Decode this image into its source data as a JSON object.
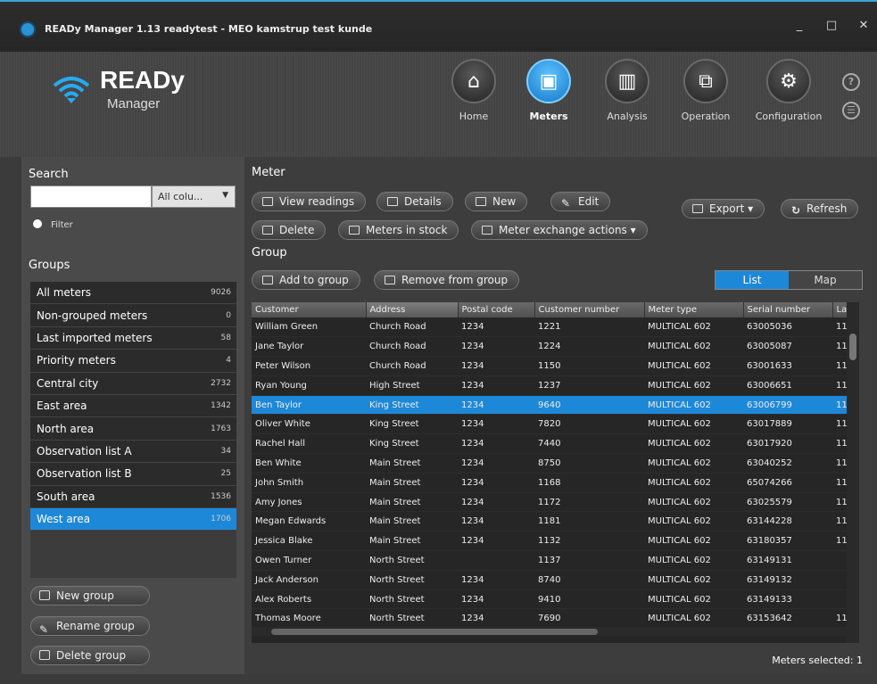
{
  "window": {
    "title": "READy Manager 1.13 readytest - MEO kamstrup test kunde",
    "minimize": "_",
    "maximize": "□",
    "close": "✕"
  },
  "logo": {
    "title": "READy",
    "subtitle": "Manager"
  },
  "nav": [
    {
      "label": "Home",
      "icon": "home-icon",
      "glyph": "⌂",
      "active": false
    },
    {
      "label": "Meters",
      "icon": "meter-icon",
      "glyph": "▣",
      "active": true
    },
    {
      "label": "Analysis",
      "icon": "chart-icon",
      "glyph": "▥",
      "active": false
    },
    {
      "label": "Operation",
      "icon": "operation-icon",
      "glyph": "⧉",
      "active": false
    },
    {
      "label": "Configuration",
      "icon": "gear-icon",
      "glyph": "⚙",
      "active": false
    }
  ],
  "help": {
    "glyph": "?",
    "info_glyph": "☰"
  },
  "search": {
    "heading": "Search",
    "value": "",
    "column_select": "All colu...",
    "filter_label": "Filter"
  },
  "groups": {
    "heading": "Groups",
    "items": [
      {
        "name": "All meters",
        "count": "9026"
      },
      {
        "name": "Non-grouped meters",
        "count": "0"
      },
      {
        "name": "Last imported meters",
        "count": "58"
      },
      {
        "name": "Priority meters",
        "count": "4"
      },
      {
        "name": "Central city",
        "count": "2732"
      },
      {
        "name": "East area",
        "count": "1342"
      },
      {
        "name": "North area",
        "count": "1763"
      },
      {
        "name": "Observation list A",
        "count": "34"
      },
      {
        "name": "Observation list B",
        "count": "25"
      },
      {
        "name": "South area",
        "count": "1536"
      },
      {
        "name": "West area",
        "count": "1706"
      }
    ],
    "selected_index": 10,
    "new_label": "New group",
    "rename_label": "Rename group",
    "delete_label": "Delete group"
  },
  "meter": {
    "heading": "Meter",
    "view_readings": "View readings",
    "details": "Details",
    "new": "New",
    "edit": "Edit",
    "delete": "Delete",
    "in_stock": "Meters in stock",
    "exchange": "Meter exchange actions ▾",
    "export": "Export ▾",
    "refresh": "Refresh"
  },
  "group": {
    "heading": "Group",
    "add": "Add to group",
    "remove": "Remove from group"
  },
  "view_toggle": {
    "list": "List",
    "map": "Map"
  },
  "table": {
    "columns": [
      "Customer",
      "Address",
      "Postal code",
      "Customer number",
      "Meter type",
      "Serial number",
      "Latest"
    ],
    "rows": [
      [
        "William Green",
        "Church Road",
        "1234",
        "1221",
        "MULTICAL 602",
        "63005036",
        "11"
      ],
      [
        "Jane Taylor",
        "Church Road",
        "1234",
        "1224",
        "MULTICAL 602",
        "63005087",
        "11"
      ],
      [
        "Peter Wilson",
        "Church Road",
        "1234",
        "1150",
        "MULTICAL 602",
        "63001633",
        "11"
      ],
      [
        "Ryan Young",
        "High Street",
        "1234",
        "1237",
        "MULTICAL 602",
        "63006651",
        "11"
      ],
      [
        "Ben Taylor",
        "King Street",
        "1234",
        "9640",
        "MULTICAL 602",
        "63006799",
        "11"
      ],
      [
        "Oliver White",
        "King Street",
        "1234",
        "7820",
        "MULTICAL 602",
        "63017889",
        "11"
      ],
      [
        "Rachel Hall",
        "King Street",
        "1234",
        "7440",
        "MULTICAL 602",
        "63017920",
        "11"
      ],
      [
        "Ben White",
        "Main Street",
        "1234",
        "8750",
        "MULTICAL 602",
        "63040252",
        "11"
      ],
      [
        "John Smith",
        "Main Street",
        "1234",
        "1168",
        "MULTICAL 602",
        "65074266",
        "11"
      ],
      [
        "Amy Jones",
        "Main Street",
        "1234",
        "1172",
        "MULTICAL 602",
        "63025579",
        "11"
      ],
      [
        "Megan Edwards",
        "Main Street",
        "1234",
        "1181",
        "MULTICAL 602",
        "63144228",
        "11"
      ],
      [
        "Jessica Blake",
        "Main Street",
        "1234",
        "1132",
        "MULTICAL 602",
        "63180357",
        "11"
      ],
      [
        "Owen Turner",
        "North Street",
        "",
        "1137",
        "MULTICAL 602",
        "63149131",
        ""
      ],
      [
        "Jack Anderson",
        "North Street",
        "1234",
        "8740",
        "MULTICAL 602",
        "63149132",
        ""
      ],
      [
        "Alex Roberts",
        "North Street",
        "1234",
        "9410",
        "MULTICAL 602",
        "63149133",
        ""
      ],
      [
        "Thomas Moore",
        "North Street",
        "1234",
        "7690",
        "MULTICAL 602",
        "63153642",
        "11"
      ]
    ],
    "selected_index": 4
  },
  "status": "Meters selected: 1"
}
